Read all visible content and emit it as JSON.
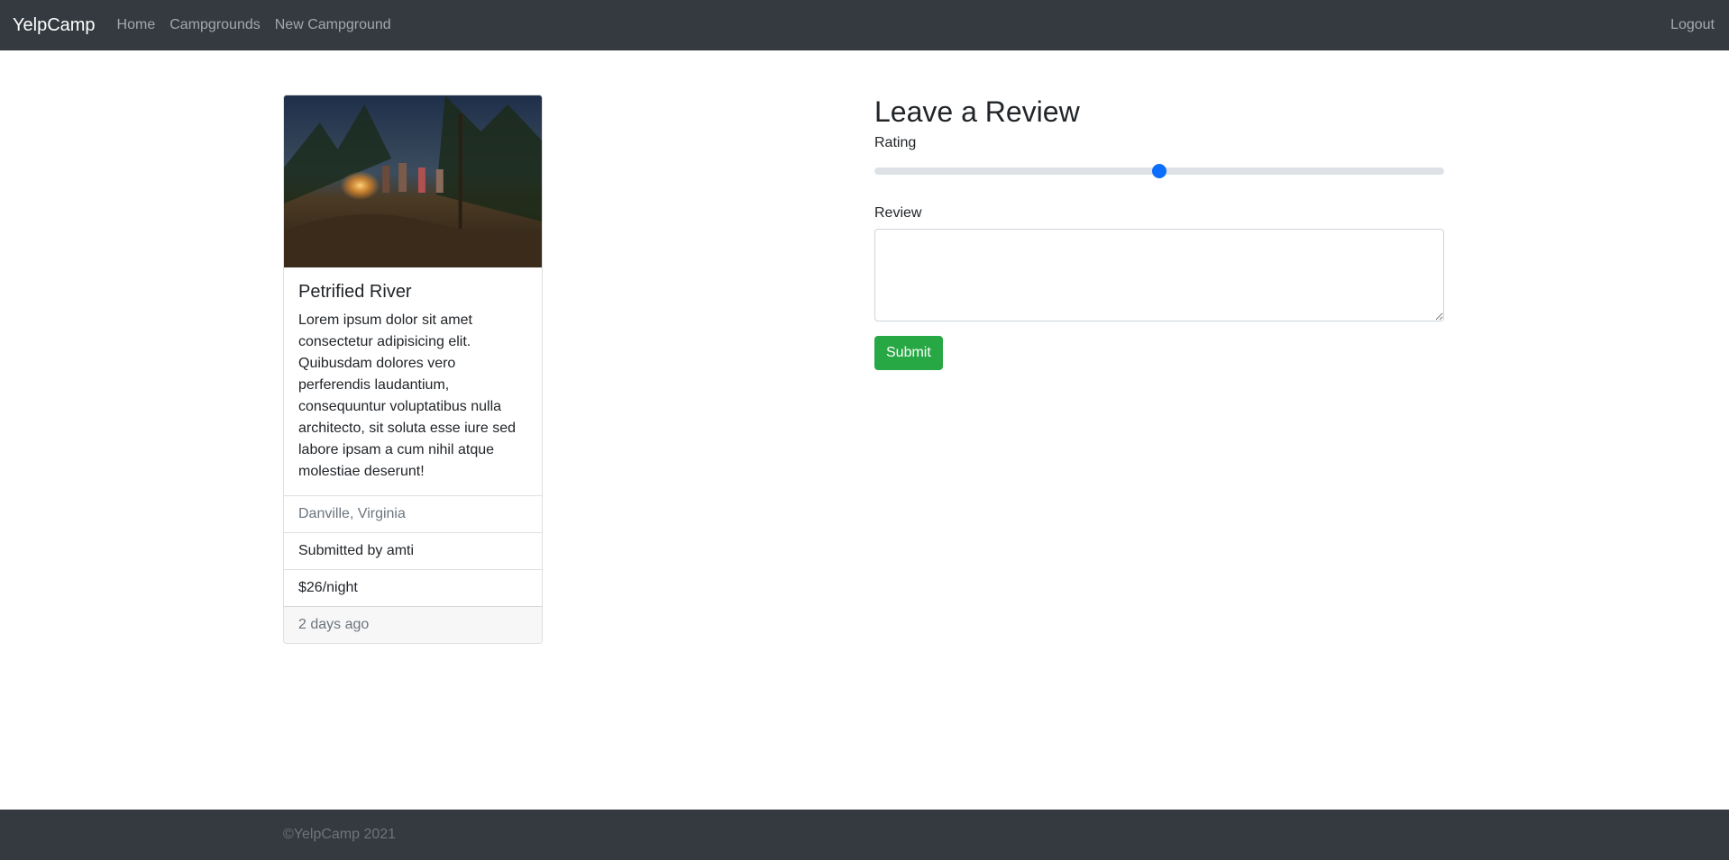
{
  "navbar": {
    "brand": "YelpCamp",
    "links": [
      "Home",
      "Campgrounds",
      "New Campground"
    ],
    "logout": "Logout"
  },
  "campground": {
    "title": "Petrified River",
    "description": "Lorem ipsum dolor sit amet consectetur adipisicing elit. Quibusdam dolores vero perferendis laudantium, consequuntur voluptatibus nulla architecto, sit soluta esse iure sed labore ipsam a cum nihil atque molestiae deserunt!",
    "location": "Danville, Virginia",
    "submitted_by": "Submitted by amti",
    "price": "$26/night",
    "posted": "2 days ago"
  },
  "review_form": {
    "heading": "Leave a Review",
    "rating_label": "Rating",
    "rating_level": 0.5,
    "review_label": "Review",
    "review_value": "",
    "submit_label": "Submit"
  },
  "footer": {
    "text": "©YelpCamp 2021"
  },
  "colors": {
    "navbar_bg": "#343a40",
    "submit_green": "#28a745",
    "slider_blue": "#0d6efd"
  }
}
